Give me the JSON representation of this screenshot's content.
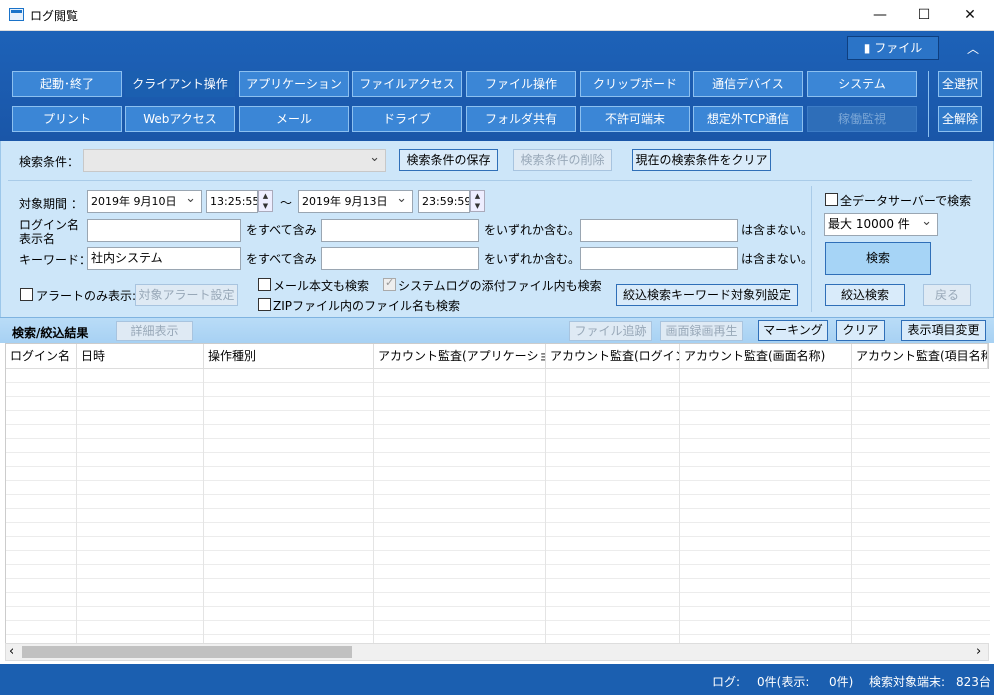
{
  "window": {
    "title": "ログ閲覧",
    "minimize": "—",
    "maximize": "☐",
    "close": "✕"
  },
  "ribbon": {
    "file_label": "ファイル",
    "collapse": "︿",
    "row1": [
      "起動･終了",
      "クライアント操作",
      "アプリケーション",
      "ファイルアクセス",
      "ファイル操作",
      "クリップボード",
      "通信デバイス",
      "システム"
    ],
    "row2": [
      "プリント",
      "Webアクセス",
      "メール",
      "ドライブ",
      "フォルダ共有",
      "不許可端末",
      "想定外TCP通信",
      "稼働監視"
    ],
    "select_all": "全選択",
    "clear_all": "全解除"
  },
  "search": {
    "condition_label": "検索条件：",
    "condition_value": "",
    "save_btn": "検索条件の保存",
    "delete_btn": "検索条件の削除",
    "clear_btn": "現在の検索条件をクリア",
    "period_label": "対象期間 ：",
    "date_from": "2019年 9月10日",
    "time_from": "13:25:55",
    "tilde": "～",
    "date_to": "2019年 9月13日",
    "time_to": "23:59:59",
    "login_label_1": "ログイン名",
    "login_label_2": "表示名",
    "keyword_label": "キーワード：",
    "login_value": "",
    "keyword_value": "社内システム",
    "all_include": "をすべて含み",
    "any_include": "をいずれか含む。",
    "not_include": "は含まない。",
    "alert_only": "アラートのみ表示:",
    "alert_setting": "対象アラート設定",
    "mail_body": "メール本文も検索",
    "syslog_attach": "システムログの添付ファイル内も検索",
    "zip_names": "ZIPファイル内のファイル名も検索",
    "refine_setting": "絞込検索キーワード対象列設定",
    "all_servers": "全データサーバーで検索",
    "max_rows": "最大 10000 件",
    "search_btn": "検索",
    "refine_btn": "絞込検索",
    "back_btn": "戻る"
  },
  "results": {
    "title": "検索/絞込結果",
    "detail_btn": "詳細表示",
    "file_trace_btn": "ファイル追跡",
    "screen_play_btn": "画面録画再生",
    "marking_btn": "マーキング",
    "clear_btn": "クリア",
    "columns_btn": "表示項目変更",
    "columns": [
      "ログイン名",
      "日時",
      "操作種別",
      "アカウント監査(アプリケーショ…",
      "アカウント監査(ログイン…",
      "アカウント監査(画面名称)",
      "アカウント監査(項目名称"
    ]
  },
  "status": {
    "log": "ログ:",
    "log_count": "0件(表示:",
    "shown_count": "0件)",
    "target_label": "検索対象端末:",
    "target_count": "823台"
  },
  "scroll": {
    "left": "‹",
    "right": "›"
  }
}
